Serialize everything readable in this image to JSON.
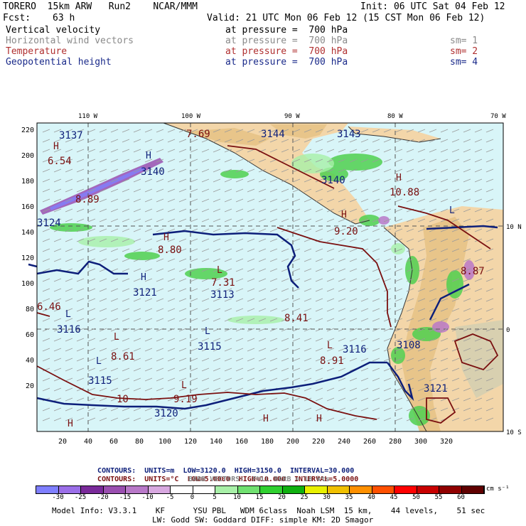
{
  "header": {
    "title_left": "TORERO  15km ARW   Run2    NCAR/MMM",
    "init": "Init: 06 UTC Sat 04 Feb 12",
    "fcst_label": "Fcst:",
    "fcst_value": "63 h",
    "valid": "Valid: 21 UTC Mon 06 Feb 12 (15 CST Mon 06 Feb 12)"
  },
  "fields": [
    {
      "name": "Vertical velocity",
      "level": "at pressure =  700 hPa",
      "sm": ""
    },
    {
      "name": "Horizontal wind vectors",
      "level": "at pressure =  700 hPa",
      "sm": "sm= 1"
    },
    {
      "name": "Temperature",
      "level": "at pressure =  700 hPa",
      "sm": "sm= 2"
    },
    {
      "name": "Geopotential height",
      "level": "at pressure =  700 hPa",
      "sm": "sm= 4"
    }
  ],
  "map": {
    "top_lon_labels": [
      "110 W",
      "100 W",
      "90 W",
      "80 W",
      "70 W"
    ],
    "right_lat_labels": [
      "10 N",
      "0",
      "10 S"
    ],
    "x_ticks": [
      "20",
      "40",
      "60",
      "80",
      "100",
      "120",
      "140",
      "160",
      "180",
      "200",
      "220",
      "240",
      "260",
      "280",
      "300",
      "320"
    ],
    "y_ticks": [
      "220",
      "200",
      "180",
      "160",
      "140",
      "120",
      "100",
      "80",
      "60",
      "40",
      "20"
    ],
    "height_labels": [
      {
        "text": "3137"
      },
      {
        "text": "3144"
      },
      {
        "text": "3143"
      },
      {
        "text": "3140"
      },
      {
        "text": "3140"
      },
      {
        "text": "3121"
      },
      {
        "text": "3113"
      },
      {
        "text": "3116"
      },
      {
        "text": "3115"
      },
      {
        "text": "3116"
      },
      {
        "text": "3115"
      },
      {
        "text": "3120"
      },
      {
        "text": "3121"
      },
      {
        "text": "3108"
      },
      {
        "text": "3124"
      }
    ],
    "temp_labels": [
      {
        "text": "6.54"
      },
      {
        "text": "7.69"
      },
      {
        "text": "9.20"
      },
      {
        "text": "10.88"
      },
      {
        "text": "8.89"
      },
      {
        "text": "8.80"
      },
      {
        "text": "7.31"
      },
      {
        "text": "8.41"
      },
      {
        "text": "8.61"
      },
      {
        "text": "8.91"
      },
      {
        "text": "9.19"
      },
      {
        "text": "10"
      },
      {
        "text": "6.46"
      },
      {
        "text": "8.87"
      }
    ],
    "colors": {
      "ocean": "#d8f5f8",
      "land": "#f3d6a9",
      "highland": "#e8c58a",
      "height_contour": "#0d1f7a",
      "temp_contour": "#7a1010",
      "grid": "#555555"
    }
  },
  "legend": {
    "line1_prefix": "CONTOURS:  UNITS=m  LOW=",
    "line1_low": "3120.0",
    "line1_high_label": "HIGH=",
    "line1_high": "3150.0",
    "line1_int_label": "INTERVAL=",
    "line1_int": "30.000",
    "line2_prefix": "CONTOURS:  UNITS=°C  LOW=",
    "line2_low": "5.0000",
    "line2_high_label": "HIGH=",
    "line2_high": "10.000",
    "line2_int_label": "INTERVAL=",
    "line2_int": "5.0000",
    "barb": "BARB VECTORS:  FULL BARB = 10 kts"
  },
  "colorbar": {
    "labels": [
      "-30",
      "-25",
      "-20",
      "-15",
      "-10",
      "-5",
      "0",
      "5",
      "10",
      "15",
      "20",
      "25",
      "30",
      "35",
      "40",
      "45",
      "50",
      "55",
      "60"
    ],
    "units": "cm s⁻¹",
    "colors": [
      "#7f7fff",
      "#9b6fe8",
      "#7a2a9a",
      "#9a4fb0",
      "#b878c8",
      "#d8a8e0",
      "#ffffff",
      "#ffffff",
      "#a8f0a8",
      "#70e070",
      "#30d030",
      "#10b010",
      "#e8f000",
      "#f0c000",
      "#ff9000",
      "#ff5000",
      "#ff0000",
      "#c80000",
      "#900000",
      "#600000"
    ]
  },
  "footer": {
    "line1": "Model Info: V3.3.1    KF      YSU PBL   WDM 6class  Noah LSM  15 km,    44 levels,    51 sec",
    "line2": "LW: Godd SW: Goddard DIFF: simple KM: 2D Smagor"
  }
}
